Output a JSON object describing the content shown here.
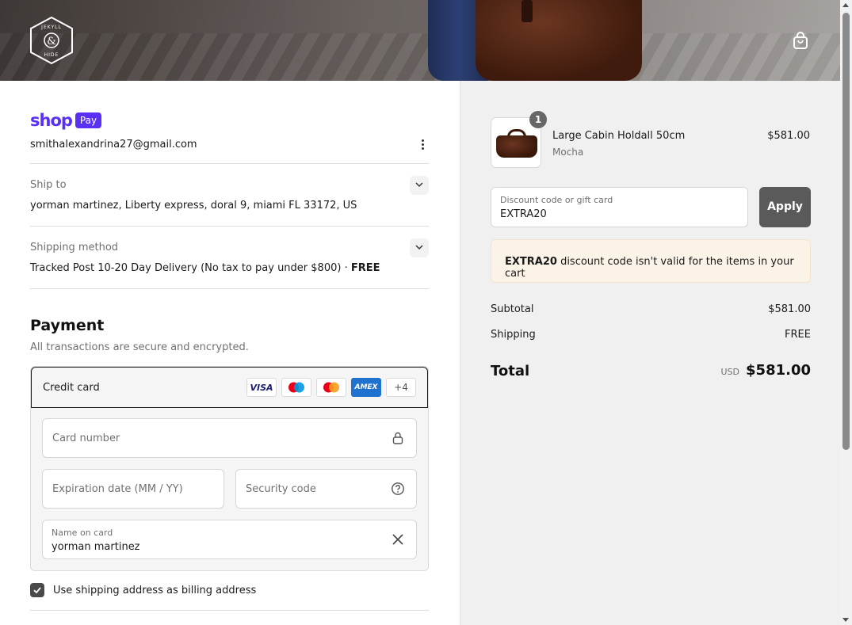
{
  "header": {
    "logo_text": "JEKYLL & HIDE",
    "cart_icon": "shopping-bag-icon"
  },
  "checkout": {
    "shoppay": {
      "shop": "shop",
      "pay": "Pay"
    },
    "email": "smithalexandrina27@gmail.com",
    "ship_to": {
      "label": "Ship to",
      "value": "yorman martinez, Liberty express, doral 9, miami FL 33172, US"
    },
    "shipping_method": {
      "label": "Shipping method",
      "value": "Tracked Post 10-20 Day Delivery (No tax to pay under $800) · ",
      "price": "FREE"
    },
    "payment": {
      "title": "Payment",
      "subtitle": "All transactions are secure and encrypted.",
      "method_label": "Credit card",
      "brands": [
        "VISA",
        "Maestro",
        "Mastercard",
        "AMEX",
        "+4"
      ],
      "card_number_placeholder": "Card number",
      "expiration_placeholder": "Expiration date (MM / YY)",
      "security_placeholder": "Security code",
      "name_label": "Name on card",
      "name_value": "yorman martinez"
    },
    "billing": {
      "label": "Use shipping address as billing address",
      "checked": true
    }
  },
  "summary": {
    "product": {
      "quantity": "1",
      "name": "Large Cabin Holdall 50cm",
      "variant": "Mocha",
      "price": "$581.00"
    },
    "discount": {
      "label": "Discount code or gift card",
      "value": "EXTRA20",
      "apply_label": "Apply"
    },
    "warning": {
      "code": "EXTRA20",
      "message": " discount code isn't valid for the items in your cart"
    },
    "subtotal": {
      "label": "Subtotal",
      "value": "$581.00"
    },
    "shipping": {
      "label": "Shipping",
      "value": "FREE"
    },
    "total": {
      "label": "Total",
      "currency": "USD",
      "value": "$581.00"
    }
  },
  "colors": {
    "shoppay_purple": "#5a31f4",
    "apply_button": "#5a5a5a",
    "warning_bg": "#fbf3e7"
  }
}
